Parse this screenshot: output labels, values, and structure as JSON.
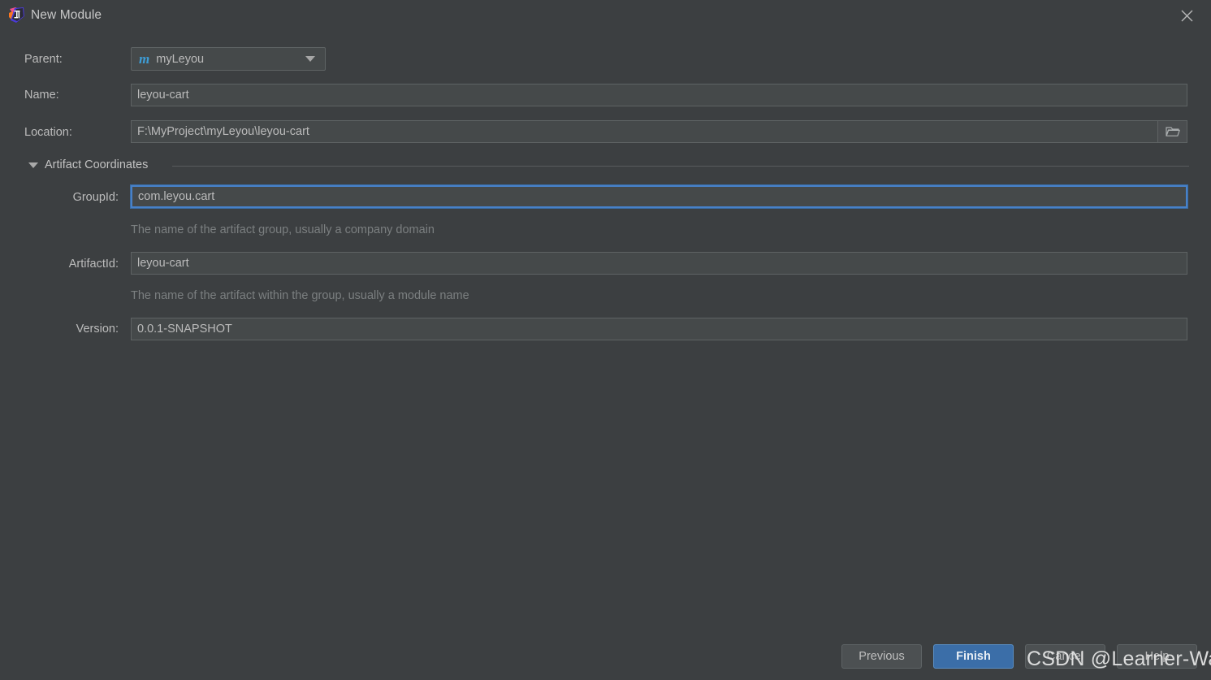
{
  "window": {
    "title": "New Module",
    "app_icon": "intellij-idea-icon",
    "close_icon": "close-icon"
  },
  "form": {
    "parent": {
      "label": "Parent:",
      "value": "myLeyou",
      "icon": "maven-module-icon",
      "dropdown_icon": "chevron-down-icon"
    },
    "name": {
      "label": "Name:",
      "value": "leyou-cart"
    },
    "location": {
      "label": "Location:",
      "value": "F:\\MyProject\\myLeyou\\leyou-cart",
      "browse_icon": "folder-icon"
    }
  },
  "artifact_section": {
    "label": "Artifact Coordinates",
    "expanded": true,
    "toggle_icon": "triangle-down-icon",
    "group_id": {
      "label": "GroupId:",
      "value": "com.leyou.cart",
      "hint": "The name of the artifact group, usually a company domain",
      "focused": true
    },
    "artifact_id": {
      "label": "ArtifactId:",
      "value": "leyou-cart",
      "hint": "The name of the artifact within the group, usually a module name"
    },
    "version": {
      "label": "Version:",
      "value": "0.0.1-SNAPSHOT"
    }
  },
  "buttons": {
    "previous": "Previous",
    "finish": "Finish",
    "cancel": "Cancel",
    "help": "Help"
  },
  "watermark": {
    "text": "CSDN @Learner-Wang"
  },
  "colors": {
    "dialog_background": "#3c3f41",
    "field_background": "#45494a",
    "focus_border": "#4781c9",
    "primary_button": "#3b6ea8",
    "maven_icon": "#3d9dd6",
    "hint_text": "#7b7f80"
  }
}
